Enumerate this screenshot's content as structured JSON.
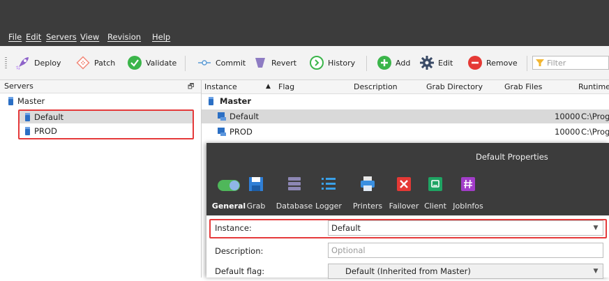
{
  "menu": {
    "items": [
      "File",
      "Edit",
      "Servers",
      "View",
      "Revision",
      "Help"
    ]
  },
  "toolbar": {
    "buttons": [
      {
        "label": "Deploy",
        "icon": "rocket-icon"
      },
      {
        "label": "Patch",
        "icon": "patch-icon"
      },
      {
        "label": "Validate",
        "icon": "check-circle-icon"
      },
      {
        "label": "Commit",
        "icon": "commit-icon"
      },
      {
        "label": "Revert",
        "icon": "funnel-revert-icon"
      },
      {
        "label": "History",
        "icon": "history-icon"
      },
      {
        "label": "Add",
        "icon": "plus-circle-icon"
      },
      {
        "label": "Edit",
        "icon": "gear-icon"
      },
      {
        "label": "Remove",
        "icon": "minus-circle-icon"
      }
    ],
    "filter_placeholder": "Filter"
  },
  "servers_panel": {
    "title": "Servers",
    "tree": {
      "root": "Master",
      "children": [
        "Default",
        "PROD"
      ]
    }
  },
  "grid": {
    "columns": [
      "Instance",
      "Flag",
      "Description",
      "Grab Directory",
      "Grab Files",
      "Runtime"
    ],
    "group": "Master",
    "rows": [
      {
        "instance": "Default",
        "grab_files": "10000",
        "runtime": "C:\\Prog"
      },
      {
        "instance": "PROD",
        "grab_files": "10000",
        "runtime": "C:\\Prog"
      }
    ]
  },
  "dialog": {
    "title": "Default Properties",
    "tabs": [
      {
        "label": "General",
        "active": true
      },
      {
        "label": "Grab"
      },
      {
        "label": "Database"
      },
      {
        "label": "Logger"
      },
      {
        "label": "Printers"
      },
      {
        "label": "Failover"
      },
      {
        "label": "Client"
      },
      {
        "label": "JobInfos"
      }
    ],
    "fields": {
      "instance_label": "Instance:",
      "instance_value": "Default",
      "description_label": "Description:",
      "description_placeholder": "Optional",
      "flag_label": "Default flag:",
      "flag_value": "Default (Inherited from Master)"
    }
  },
  "colors": {
    "highlight": "#e5393a",
    "dark_chrome": "#3c3c3c",
    "selection": "#d9d9d9"
  }
}
